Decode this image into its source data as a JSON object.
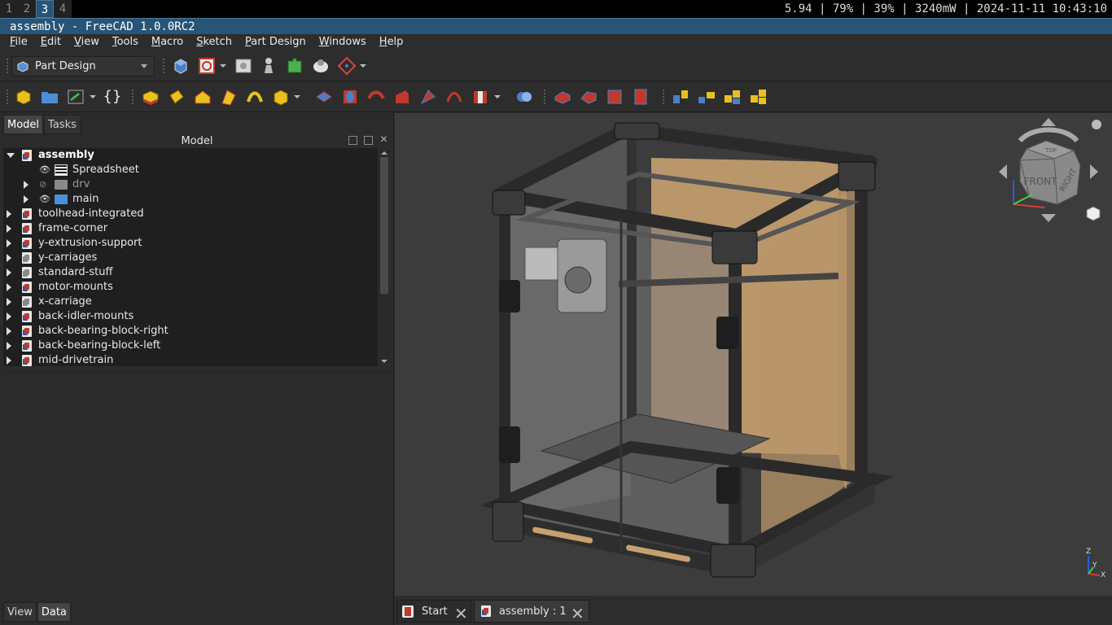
{
  "topbar": {
    "workspaces": [
      "1",
      "2",
      "3",
      "4"
    ],
    "active_workspace": "3",
    "status": "5.94 | 79% | 39% | 3240mW | 2024-11-11 10:43:10"
  },
  "window": {
    "title": "assembly - FreeCAD 1.0.0RC2"
  },
  "menu": [
    "File",
    "Edit",
    "View",
    "Tools",
    "Macro",
    "Sketch",
    "Part Design",
    "Windows",
    "Help"
  ],
  "workbench": {
    "selected": "Part Design"
  },
  "panel": {
    "tabs": [
      "Model",
      "Tasks"
    ],
    "active_tab": "Model",
    "header": "Model",
    "bottom_tabs": [
      "View",
      "Data"
    ],
    "active_bottom_tab": "Data"
  },
  "tree": {
    "root": "assembly",
    "children": [
      {
        "label": "Spreadsheet"
      },
      {
        "label": "drv"
      },
      {
        "label": "main"
      }
    ],
    "items": [
      "toolhead-integrated",
      "frame-corner",
      "y-extrusion-support",
      "y-carriages",
      "standard-stuff",
      "motor-mounts",
      "x-carriage",
      "back-idler-mounts",
      "back-bearing-block-right",
      "back-bearing-block-left",
      "mid-drivetrain"
    ]
  },
  "navcube": {
    "front": "FRONT",
    "right": "RIGHT",
    "top": "TOP"
  },
  "axes": {
    "z": "Z",
    "y": "Y",
    "x": "X"
  },
  "doc_tabs": [
    {
      "label": "Start",
      "active": false
    },
    {
      "label": "assembly : 1",
      "active": true
    }
  ],
  "colors": {
    "accent": "#285577",
    "frame": "#2a2a2a",
    "panel_wood": "#c8a070",
    "background": "#3c3c3c"
  }
}
